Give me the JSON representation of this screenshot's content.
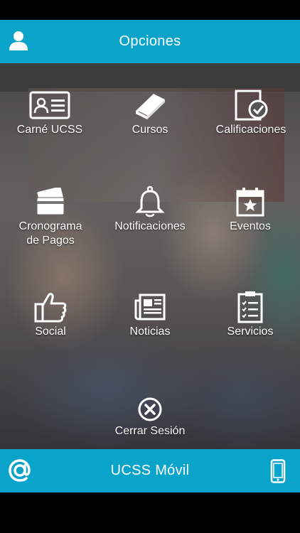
{
  "header": {
    "title": "Opciones",
    "user_icon": "user-icon"
  },
  "menu": {
    "carne": {
      "label": "Carné UCSS",
      "icon": "id-card-icon"
    },
    "cursos": {
      "label": "Cursos",
      "icon": "book-icon"
    },
    "calificaciones": {
      "label": "Calificaciones",
      "icon": "grades-check-icon"
    },
    "cronograma": {
      "label_line1": "Cronograma",
      "label_line2": "de Pagos",
      "icon": "credit-card-icon"
    },
    "notificaciones": {
      "label": "Notificaciones",
      "icon": "bell-icon"
    },
    "eventos": {
      "label": "Eventos",
      "icon": "calendar-star-icon"
    },
    "social": {
      "label": "Social",
      "icon": "thumbs-up-icon"
    },
    "noticias": {
      "label": "Noticias",
      "icon": "newspaper-icon"
    },
    "servicios": {
      "label": "Servicios",
      "icon": "clipboard-checklist-icon"
    },
    "cerrar": {
      "label": "Cerrar Sesión",
      "icon": "close-circle-icon"
    }
  },
  "footer": {
    "title": "UCSS Móvil",
    "left_icon": "at-sign-icon",
    "right_icon": "mobile-phone-icon"
  },
  "colors": {
    "bar": "#0aa3c9",
    "text": "#ffffff",
    "background": "#000000"
  }
}
